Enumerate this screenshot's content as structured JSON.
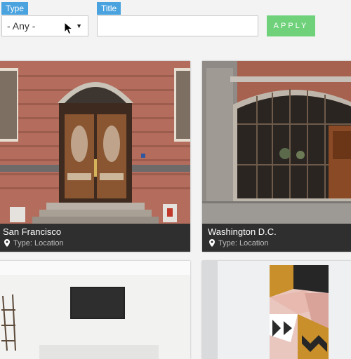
{
  "filters": {
    "type_label": "Type",
    "type_selected": "- Any -",
    "title_label": "Title",
    "title_value": "",
    "apply_label": "APPLY"
  },
  "cards": [
    {
      "title": "San Francisco",
      "type_text": "Type: Location"
    },
    {
      "title": "Washington D.C.",
      "type_text": "Type: Location"
    }
  ],
  "colors": {
    "label_bg": "#4aa3df",
    "apply_bg": "#6fd27b",
    "caption_bg": "#2f2f2f"
  }
}
